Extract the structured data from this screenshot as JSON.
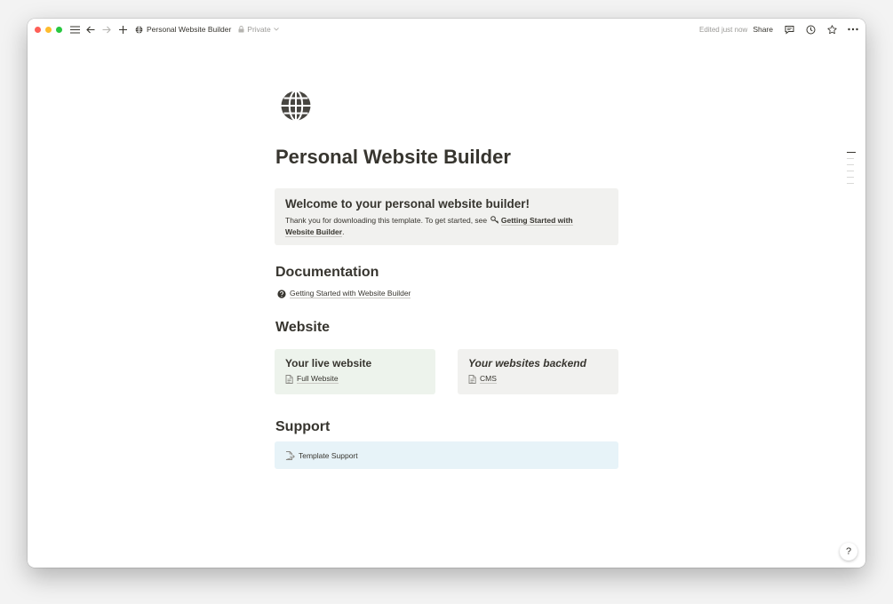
{
  "topbar": {
    "breadcrumb_title": "Personal Website Builder",
    "privacy_label": "Private",
    "edited_status": "Edited just now",
    "share_label": "Share"
  },
  "page": {
    "title": "Personal Website Builder",
    "icon": "globe-icon"
  },
  "callout": {
    "title": "Welcome to your personal website builder!",
    "text": "Thank you for downloading this template. To get started, see",
    "link_icon": "key-icon",
    "link_text_1": "Getting Started with",
    "link_text_2": "Website Builder",
    "link_suffix": "."
  },
  "documentation": {
    "heading": "Documentation",
    "link_icon": "question-circle-icon",
    "link_text": "Getting Started with Website Builder"
  },
  "website": {
    "heading": "Website",
    "cards": [
      {
        "title": "Your live website",
        "link_text": "Full Website",
        "bg": "#edf3ec"
      },
      {
        "title": "Your websites backend",
        "link_text": "CMS",
        "bg": "#f1f1ef"
      }
    ]
  },
  "support": {
    "heading": "Support",
    "link_text": "Template Support",
    "bg": "#e7f3f8"
  },
  "help_button": {
    "label": "?"
  }
}
